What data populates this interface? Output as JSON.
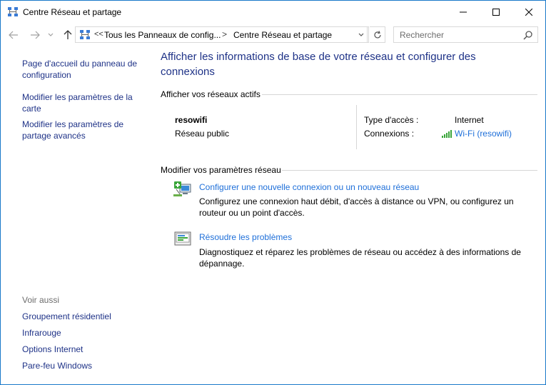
{
  "window": {
    "title": "Centre Réseau et partage"
  },
  "nav": {
    "overflow_chevron": "<<",
    "breadcrumb_1": "Tous les Panneaux de config...",
    "separator": ">",
    "breadcrumb_2": "Centre Réseau et partage",
    "search_placeholder": "Rechercher"
  },
  "sidebar": {
    "links": [
      "Page d'accueil du panneau de configuration",
      "Modifier les paramètres de la carte",
      "Modifier les paramètres de partage avancés"
    ],
    "see_also_label": "Voir aussi",
    "see_also": [
      "Groupement résidentiel",
      "Infrarouge",
      "Options Internet",
      "Pare-feu Windows"
    ]
  },
  "main": {
    "title": "Afficher les informations de base de votre réseau et configurer des connexions",
    "active_networks_header": "Afficher vos réseaux actifs",
    "network": {
      "name": "resowifi",
      "type": "Réseau public",
      "access_type_label": "Type d'accès :",
      "access_type_value": "Internet",
      "connections_label": "Connexions :",
      "connections_value": "Wi-Fi (resowifi)"
    },
    "change_settings_header": "Modifier vos paramètres réseau",
    "tasks": [
      {
        "link": "Configurer une nouvelle connexion ou un nouveau réseau",
        "description": "Configurez une connexion haut débit, d'accès à distance ou VPN, ou configurez un routeur ou un point d'accès."
      },
      {
        "link": "Résoudre les problèmes",
        "description": "Diagnostiquez et réparez les problèmes de réseau ou accédez à des informations de dépannage."
      }
    ]
  },
  "colors": {
    "link": "#1e3287",
    "link_bright": "#1e6fd9",
    "border": "#1979ca",
    "divider": "#d6d6d6"
  }
}
